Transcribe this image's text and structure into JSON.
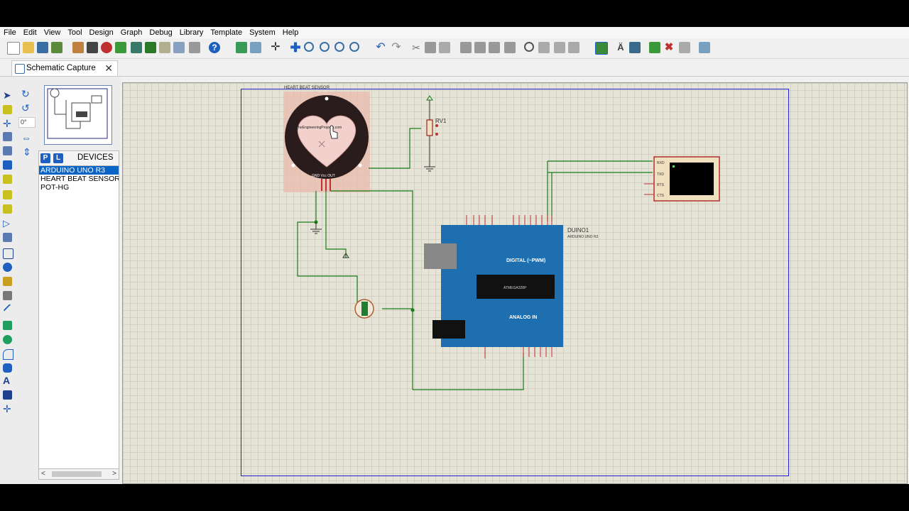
{
  "menu": [
    "File",
    "Edit",
    "View",
    "Tool",
    "Design",
    "Graph",
    "Debug",
    "Library",
    "Template",
    "System",
    "Help"
  ],
  "tab": {
    "title": "Schematic Capture",
    "close": "✕"
  },
  "side": {
    "rotation": "0°",
    "devices_label": "DEVICES",
    "p_button": "P",
    "l_button": "L",
    "devices": [
      "ARDUINO UNO R3",
      "HEART BEAT SENSOR",
      "POT-HG"
    ],
    "selected_index": 0
  },
  "schematic": {
    "sensor_title": "HEART BEAT SENSOR",
    "sensor_site": "TheEngineeringProjects.com",
    "sensor_pins": "GND Vcc OUT",
    "pot_label": "RV1",
    "arduino_name": "DUINO1",
    "arduino_part": "ARDUINO UNO R3",
    "digital_label": "DIGITAL (~PWM)",
    "analog_label": "ANALOG IN",
    "chip_text": "ATMEGA328P",
    "terminal_pins": [
      "RXD",
      "TXD",
      "RTS",
      "CTS"
    ]
  },
  "colors": {
    "wire": "#1a7a1a",
    "sheet_border": "#2222cc",
    "board": "#1e6fb0",
    "highlight": "#0a64c8"
  }
}
